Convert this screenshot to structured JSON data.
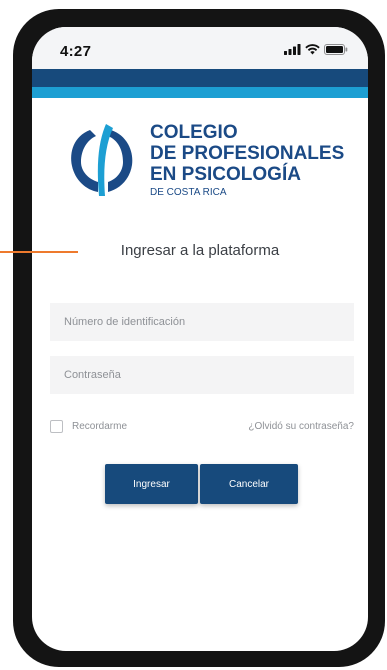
{
  "status_bar": {
    "time": "4:27",
    "icons": [
      "cellular-signal-icon",
      "wifi-icon",
      "battery-icon"
    ]
  },
  "colors": {
    "primary": "#174a7c",
    "accent": "#1d9fd3",
    "annotation": "#ee7a2d"
  },
  "logo": {
    "line1": "COLEGIO",
    "line2": "DE PROFESIONALES",
    "line3": "EN PSICOLOGÍA",
    "subtitle": "DE COSTA RICA"
  },
  "login": {
    "heading": "Ingresar a la plataforma",
    "id_placeholder": "Número de identificación",
    "password_placeholder": "Contraseña",
    "remember_label": "Recordarme",
    "forgot_label": "¿Olvidó su contraseña?",
    "submit_label": "Ingresar",
    "cancel_label": "Cancelar"
  }
}
